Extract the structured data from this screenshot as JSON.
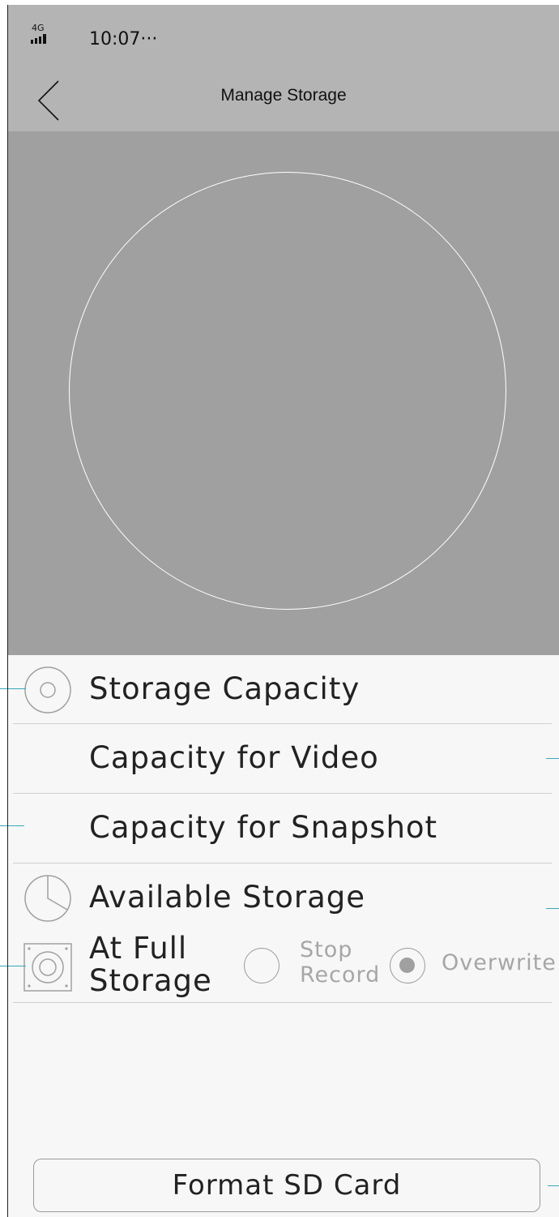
{
  "status_bar": {
    "network": "4G",
    "time": "10:07···"
  },
  "nav": {
    "title": "Manage Storage",
    "back_icon": "chevron-left-icon"
  },
  "storage_items": [
    {
      "label": "Storage Capacity",
      "icon": "disc-icon"
    },
    {
      "label": "Capacity for Video"
    },
    {
      "label": "Capacity for Snapshot"
    },
    {
      "label": "Available Storage",
      "icon": "pie-chart-icon"
    }
  ],
  "full_storage": {
    "label_line1": "At Full",
    "label_line2": "Storage",
    "icon": "hard-drive-icon",
    "options": [
      {
        "line1": "Stop",
        "line2": "Record",
        "selected": false
      },
      {
        "line1": "Overwrite",
        "selected": true
      }
    ]
  },
  "format_button": "Format SD Card",
  "colors": {
    "header_bg": "#b4b4b4",
    "hero_bg": "#a0a0a0",
    "page_bg": "#f7f7f7",
    "text": "#222222",
    "muted_text": "#a6a6a6",
    "annotation_line": "#3aa7b8"
  }
}
